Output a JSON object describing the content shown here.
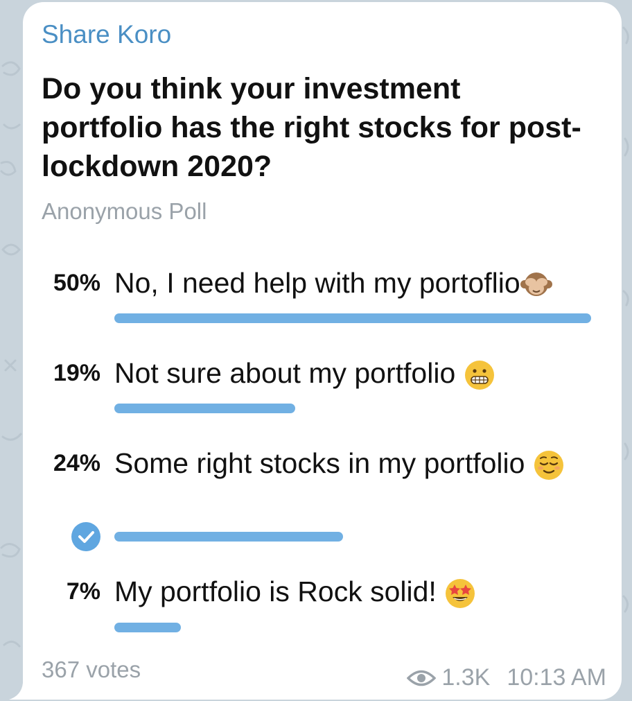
{
  "channel": {
    "name": "Share Koro"
  },
  "poll": {
    "question": "Do you think your investment portfolio has the right stocks for post-lockdown 2020?",
    "type": "Anonymous Poll",
    "options": [
      {
        "percent": "50%",
        "text": "No, I need help with my portoflio",
        "emoji": "see-no-evil-monkey-icon",
        "share": 0.5,
        "selected": false
      },
      {
        "percent": "19%",
        "text": "Not sure about my portfolio ",
        "emoji": "grimacing-face-icon",
        "share": 0.19,
        "selected": false
      },
      {
        "percent": "24%",
        "text": "Some right stocks in my portfolio ",
        "emoji": "relieved-face-icon",
        "share": 0.24,
        "selected": true
      },
      {
        "percent": "7%",
        "text": "My portfolio is Rock solid! ",
        "emoji": "star-struck-icon",
        "share": 0.07,
        "selected": false
      }
    ],
    "votes": "367 votes"
  },
  "footer": {
    "views": "1.3K",
    "time": "10:13 AM"
  },
  "colors": {
    "channel_name": "#4a8fc4",
    "bar": "#71b0e3",
    "check": "#5fa6e0",
    "muted": "#9aa2a9",
    "background": "#c9d4dc"
  }
}
